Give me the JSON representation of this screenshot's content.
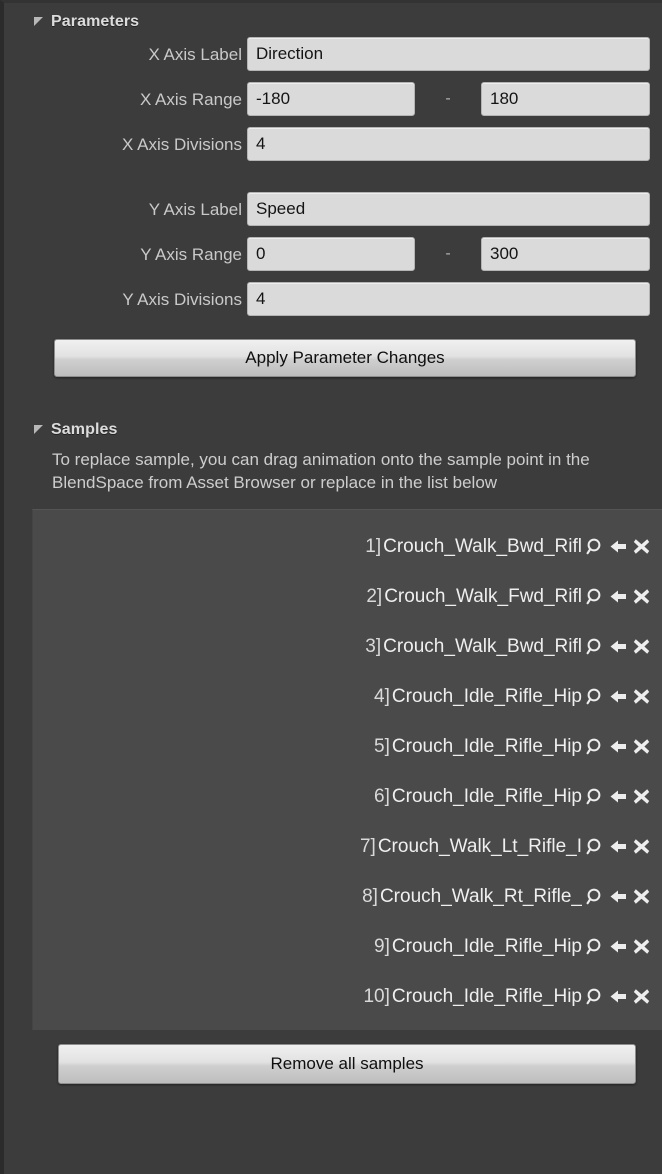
{
  "sections": {
    "parameters": {
      "title": "Parameters",
      "expander_icon": "triangle-down-icon"
    },
    "samples": {
      "title": "Samples",
      "expander_icon": "triangle-down-icon",
      "help_text": "To replace sample, you can drag animation onto the sample point in the BlendSpace from Asset Browser or replace in the list below"
    }
  },
  "parameters": {
    "x_axis_label": {
      "label": "X Axis Label",
      "value": "Direction"
    },
    "x_axis_range": {
      "label": "X Axis Range",
      "min": "-180",
      "max": "180",
      "separator": "-"
    },
    "x_axis_divisions": {
      "label": "X Axis Divisions",
      "value": "4"
    },
    "y_axis_label": {
      "label": "Y Axis Label",
      "value": "Speed"
    },
    "y_axis_range": {
      "label": "Y Axis Range",
      "min": "0",
      "max": "300",
      "separator": "-"
    },
    "y_axis_divisions": {
      "label": "Y Axis Divisions",
      "value": "4"
    },
    "apply_button": "Apply Parameter Changes"
  },
  "samples_list": {
    "items": [
      {
        "index": "1]",
        "name": "Crouch_Walk_Bwd_Rifl"
      },
      {
        "index": "2]",
        "name": "Crouch_Walk_Fwd_Rifl"
      },
      {
        "index": "3]",
        "name": "Crouch_Walk_Bwd_Rifl"
      },
      {
        "index": "4]",
        "name": "Crouch_Idle_Rifle_Hip"
      },
      {
        "index": "5]",
        "name": "Crouch_Idle_Rifle_Hip"
      },
      {
        "index": "6]",
        "name": "Crouch_Idle_Rifle_Hip"
      },
      {
        "index": "7]",
        "name": "Crouch_Walk_Lt_Rifle_I"
      },
      {
        "index": "8]",
        "name": "Crouch_Walk_Rt_Rifle_"
      },
      {
        "index": "9]",
        "name": "Crouch_Idle_Rifle_Hip"
      },
      {
        "index": "10]",
        "name": "Crouch_Idle_Rifle_Hip"
      }
    ],
    "row_icons": [
      "browse-icon",
      "use-selected-icon",
      "clear-icon"
    ],
    "remove_all_button": "Remove all samples"
  },
  "colors": {
    "panel_bg": "#3c3c3c",
    "list_bg": "#4a4a4a",
    "field_bg": "#dadada",
    "text": "#d4d4d4",
    "field_text": "#141414"
  }
}
